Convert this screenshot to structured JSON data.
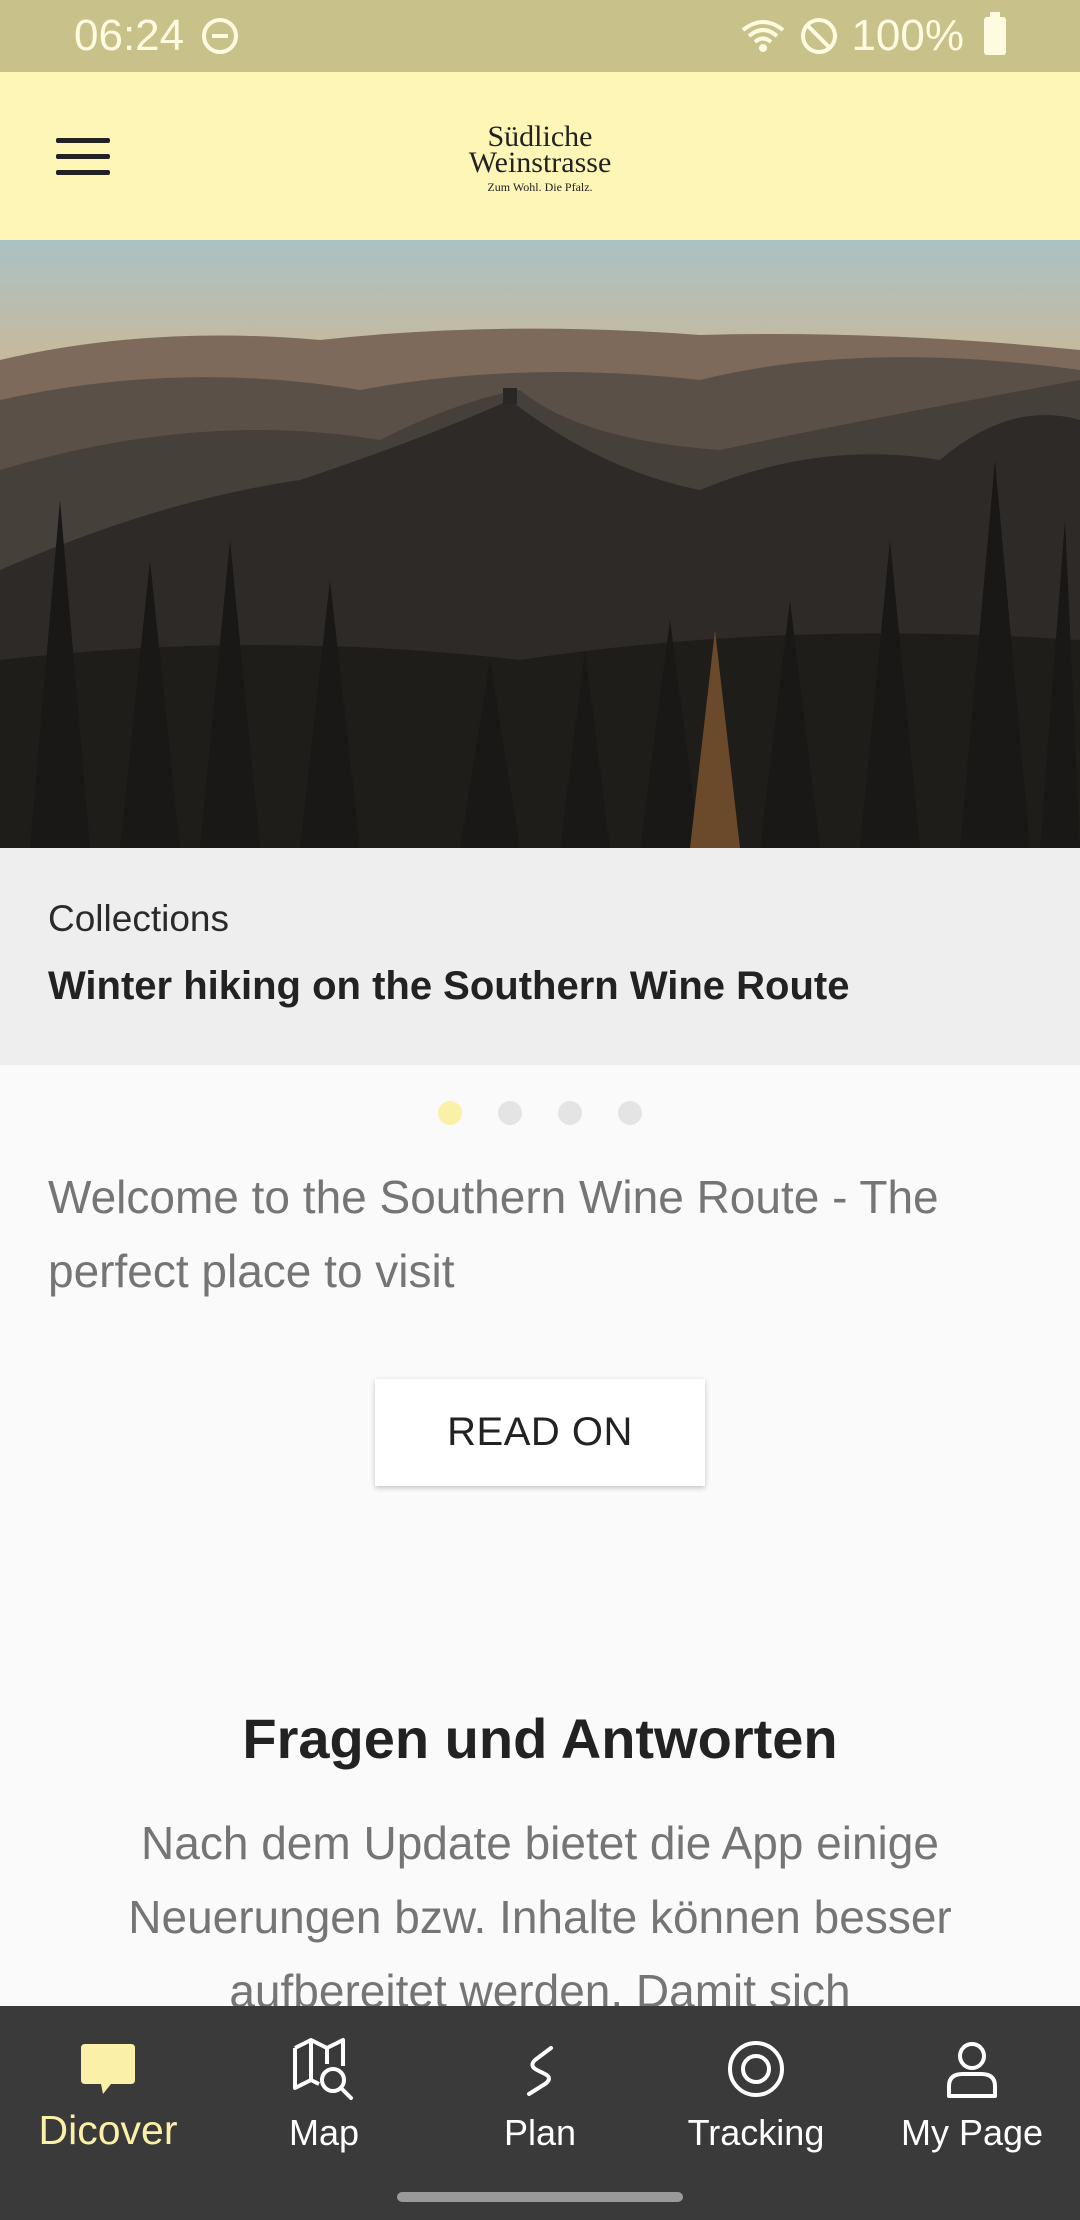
{
  "status_bar": {
    "time": "06:24",
    "battery": "100%"
  },
  "app_bar": {
    "logo_line1": "Südliche",
    "logo_line2": "Weinstrasse",
    "logo_tagline": "Zum Wohl. Die Pfalz."
  },
  "carousel": {
    "category": "Collections",
    "title": "Winter hiking on the Southern Wine Route",
    "page_count": 4,
    "active_page": 1
  },
  "welcome": {
    "text": "Welcome to the Southern Wine Route - The perfect place to visit",
    "button": "READ ON"
  },
  "faq": {
    "title": "Fragen und Antworten",
    "text": "Nach dem Update bietet die App einige Neuerungen bzw. Inhalte können besser aufbereitet werden. Damit sich"
  },
  "bottom_nav": {
    "items": [
      {
        "label": "Dicover",
        "icon": "discover-icon",
        "active": true
      },
      {
        "label": "Map",
        "icon": "map-search-icon",
        "active": false
      },
      {
        "label": "Plan",
        "icon": "route-icon",
        "active": false
      },
      {
        "label": "Tracking",
        "icon": "tracking-icon",
        "active": false
      },
      {
        "label": "My Page",
        "icon": "person-icon",
        "active": false
      }
    ],
    "active_color": "#fbf0a8",
    "inactive_color": "#ffffff"
  },
  "colors": {
    "status_bar": "#c8c28a",
    "app_bar": "#fdf6b6",
    "nav_background": "#3a3a3a"
  }
}
